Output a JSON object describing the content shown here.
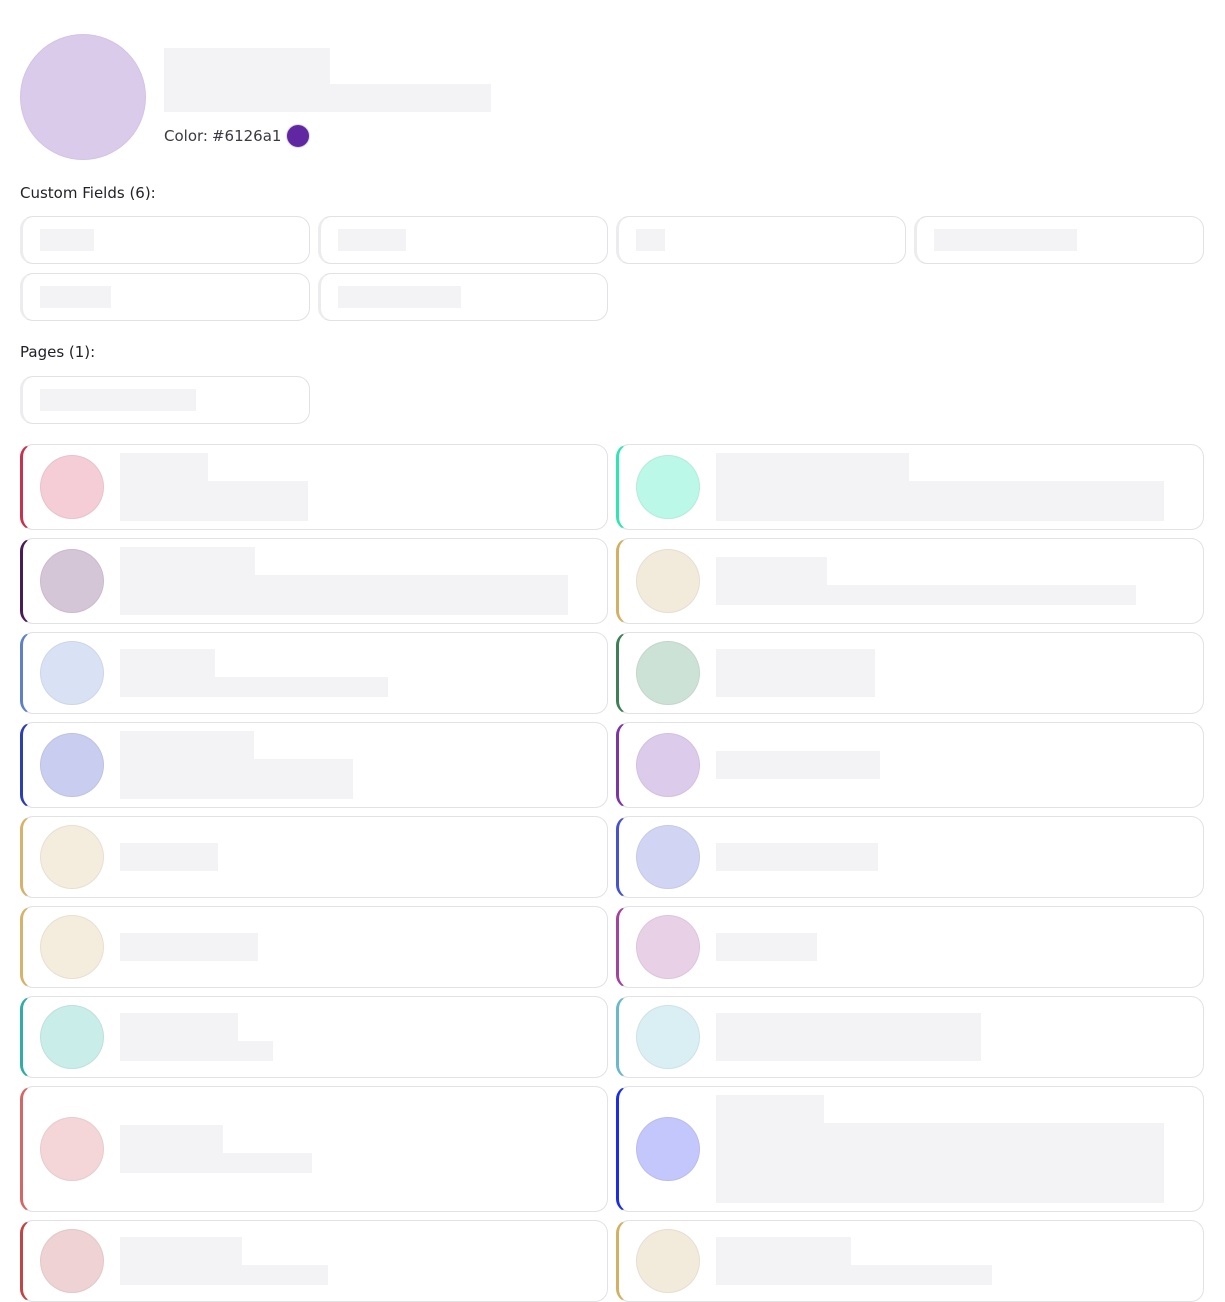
{
  "header": {
    "color_label": "Color:",
    "color_value": "#6126a1",
    "swatch_color": "#6126a1",
    "avatar_color": "#dacbea"
  },
  "custom_fields": {
    "title": "Custom Fields (6):",
    "count": 6
  },
  "pages": {
    "title": "Pages (1):",
    "count": 1
  },
  "cards": [
    {
      "accent": "#c8324e",
      "avatar": "#f4cdd6"
    },
    {
      "accent": "#2ee6b4",
      "avatar": "#bcf8e7"
    },
    {
      "accent": "#4a1c55",
      "avatar": "#d4c6d7"
    },
    {
      "accent": "#d4b064",
      "avatar": "#f2ebdc"
    },
    {
      "accent": "#5f80c8",
      "avatar": "#d9e2f4"
    },
    {
      "accent": "#3f7f57",
      "avatar": "#cde2d6"
    },
    {
      "accent": "#2b3eb4",
      "avatar": "#c9cdf0"
    },
    {
      "accent": "#7d34a6",
      "avatar": "#ddcbec"
    },
    {
      "accent": "#d6b36a",
      "avatar": "#f4ecdc"
    },
    {
      "accent": "#4652d0",
      "avatar": "#d2d4f4"
    },
    {
      "accent": "#d6b36a",
      "avatar": "#f4ecdc"
    },
    {
      "accent": "#a2449e",
      "avatar": "#e8d0e7"
    },
    {
      "accent": "#2fada6",
      "avatar": "#c9ede9"
    },
    {
      "accent": "#6bb7cc",
      "avatar": "#d9eff3"
    },
    {
      "accent": "#d86565",
      "avatar": "#f4d6d8"
    },
    {
      "accent": "#1a2de8",
      "avatar": "#c3c7fb"
    },
    {
      "accent": "#c24444",
      "avatar": "#efd2d3"
    },
    {
      "accent": "#d4b064",
      "avatar": "#f2ebdc"
    }
  ]
}
